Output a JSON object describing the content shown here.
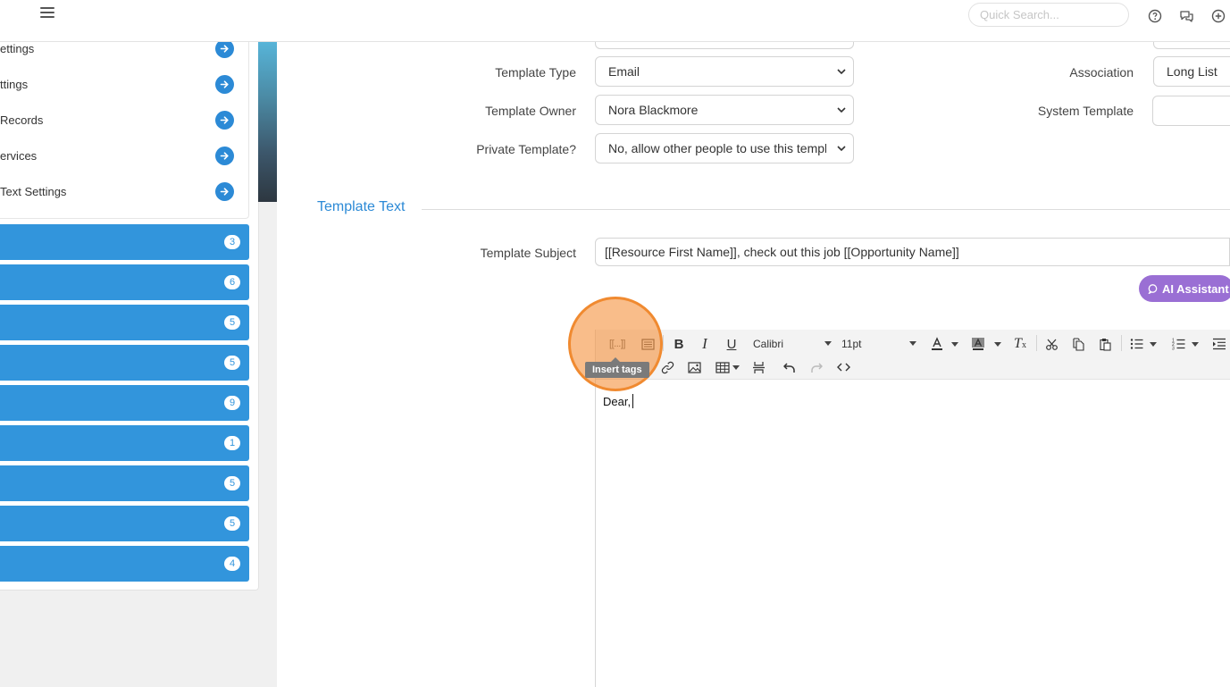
{
  "topbar": {
    "search_placeholder": "Quick Search...",
    "icons": [
      "menu-icon",
      "help-icon",
      "chat-icon",
      "add-icon"
    ]
  },
  "sidebar": {
    "settings_links": [
      {
        "label": "ettings"
      },
      {
        "label": "ttings"
      },
      {
        "label": "Records"
      },
      {
        "label": "ervices"
      },
      {
        "label": "Text Settings"
      }
    ],
    "module_counts": [
      "3",
      "6",
      "5",
      "5",
      "9",
      "1",
      "5",
      "5",
      "4"
    ]
  },
  "form": {
    "template_type_label": "Template Type",
    "template_type_value": "Email",
    "template_owner_label": "Template Owner",
    "template_owner_value": "Nora Blackmore",
    "private_label": "Private Template?",
    "private_value": "No, allow other people to use this template",
    "association_label": "Association",
    "association_value": "Long List",
    "system_template_label": "System Template",
    "system_template_value": ""
  },
  "template_text": {
    "section_title": "Template Text",
    "subject_label": "Template Subject",
    "subject_value": "[[Resource First Name]], check out this job [[Opportunity Name]]",
    "ai_button": "AI Assistant"
  },
  "editor": {
    "font_family": "Calibri",
    "font_size": "11pt",
    "insert_tags_glyph": "[[...]]",
    "tooltip": "Insert tags",
    "body_text": "Dear,"
  },
  "colors": {
    "accent": "#2c8ad6",
    "module_bar": "#3295dc",
    "ai_purple": "#9a6fd4",
    "highlight": "#f08a30"
  }
}
